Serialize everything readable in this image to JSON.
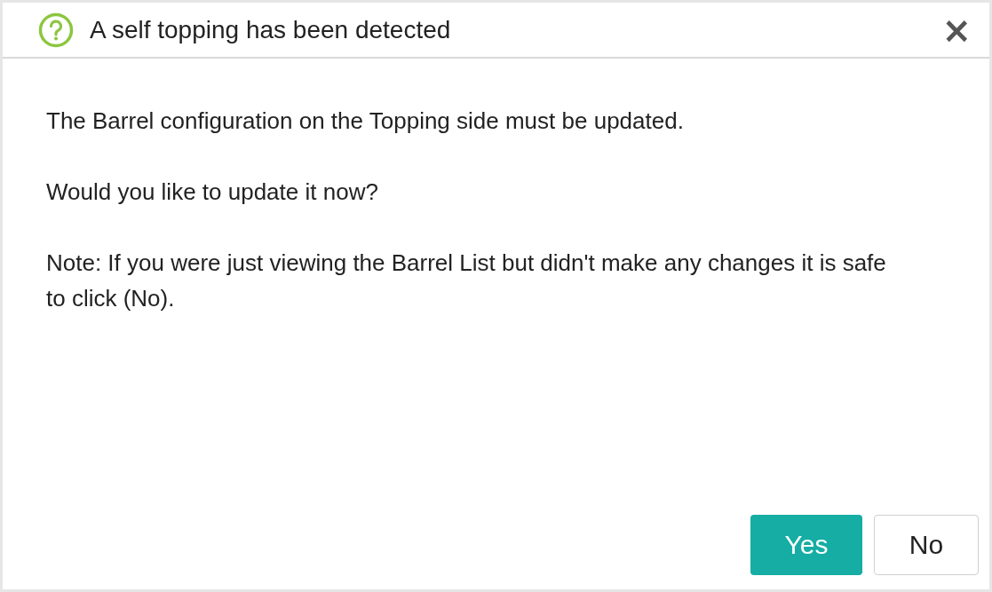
{
  "dialog": {
    "title": "A self topping has been detected",
    "close": "×",
    "paragraphs": [
      "The Barrel configuration on the Topping side must be updated.",
      "Would you like to update it now?",
      "Note: If you were just viewing the Barrel List but didn't make any changes it is safe to click (No)."
    ],
    "buttons": [
      {
        "label": "Yes",
        "kind": "primary"
      },
      {
        "label": "No",
        "kind": "secondary"
      }
    ]
  }
}
